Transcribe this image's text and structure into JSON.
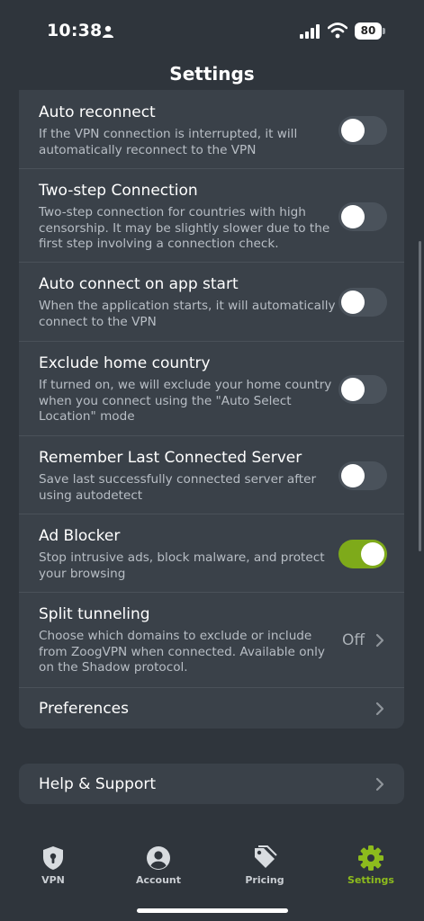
{
  "status_bar": {
    "time": "10:38",
    "battery": "80"
  },
  "header": {
    "title": "Settings"
  },
  "settings": [
    {
      "title": "Auto reconnect",
      "desc": "If the VPN connection is interrupted, it will automatically reconnect to the VPN",
      "state": "off"
    },
    {
      "title": "Two-step Connection",
      "desc": "Two-step connection for countries with high censorship. It may be slightly slower due to the first step involving a connection check.",
      "state": "off"
    },
    {
      "title": "Auto connect on app start",
      "desc": "When the application starts, it will automatically connect to the VPN",
      "state": "off"
    },
    {
      "title": "Exclude home country",
      "desc": "If turned on, we will exclude your home country when you connect using the \"Auto Select Location\" mode",
      "state": "off"
    },
    {
      "title": "Remember Last Connected Server",
      "desc": "Save last successfully connected server after using autodetect",
      "state": "off"
    },
    {
      "title": "Ad Blocker",
      "desc": "Stop intrusive ads, block malware, and protect your browsing",
      "state": "on"
    },
    {
      "title": "Split tunneling",
      "desc": "Choose which domains to exclude or include from ZoogVPN when connected. Available only on the Shadow protocol.",
      "value": "Off"
    },
    {
      "title": "Preferences"
    }
  ],
  "help": {
    "title": "Help & Support"
  },
  "tabs": [
    {
      "label": "VPN",
      "icon": "shield-icon"
    },
    {
      "label": "Account",
      "icon": "account-icon"
    },
    {
      "label": "Pricing",
      "icon": "tag-icon"
    },
    {
      "label": "Settings",
      "icon": "gear-icon",
      "active": true
    }
  ],
  "colors": {
    "accent": "#8dbb1d",
    "toggle_on": "#7eaa1a",
    "card": "#3a4149",
    "background": "#2f353c"
  }
}
